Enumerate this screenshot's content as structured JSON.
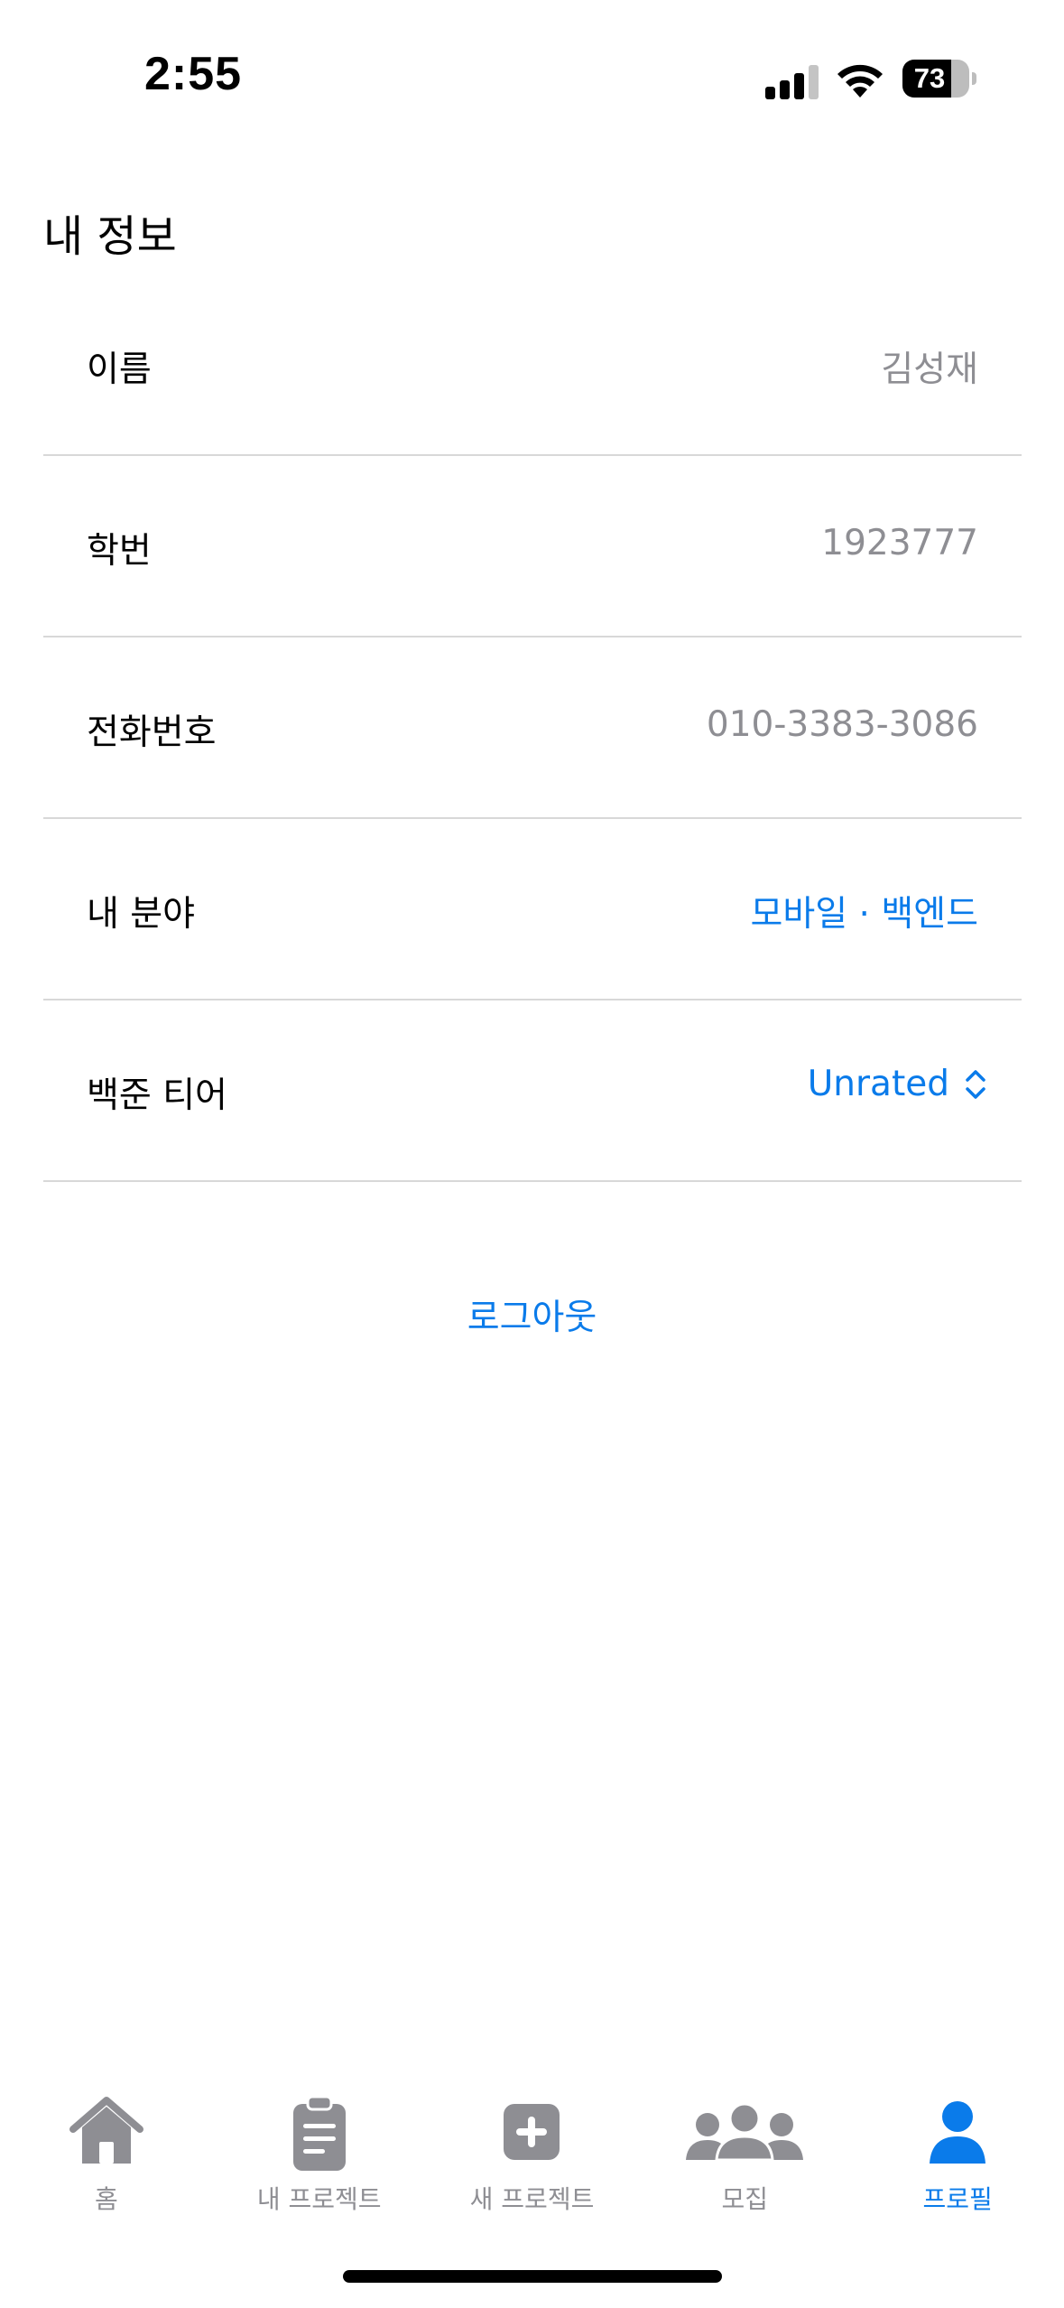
{
  "status_bar": {
    "time": "2:55",
    "battery_percent": "73",
    "battery_level": 0.73
  },
  "section": {
    "title": "내 정보"
  },
  "rows": [
    {
      "label": "이름",
      "value": "김성재"
    },
    {
      "label": "학번",
      "value": "1923777"
    },
    {
      "label": "전화번호",
      "value": "010-3383-3086"
    },
    {
      "label": "내 분야",
      "value": "모바일 · 백엔드"
    },
    {
      "label": "백준 티어",
      "value": "Unrated"
    }
  ],
  "logout_label": "로그아웃",
  "tab_bar": {
    "tabs": [
      {
        "label": "홈",
        "icon": "house-icon"
      },
      {
        "label": "내 프로젝트",
        "icon": "clipboard-icon"
      },
      {
        "label": "새 프로젝트",
        "icon": "plus-square-icon"
      },
      {
        "label": "모집",
        "icon": "people-icon"
      },
      {
        "label": "프로필",
        "icon": "person-icon"
      }
    ],
    "active_index": 4
  },
  "colors": {
    "accent": "#0a7bea",
    "secondary_text": "#8e8e93",
    "separator": "#d8d8d8"
  }
}
